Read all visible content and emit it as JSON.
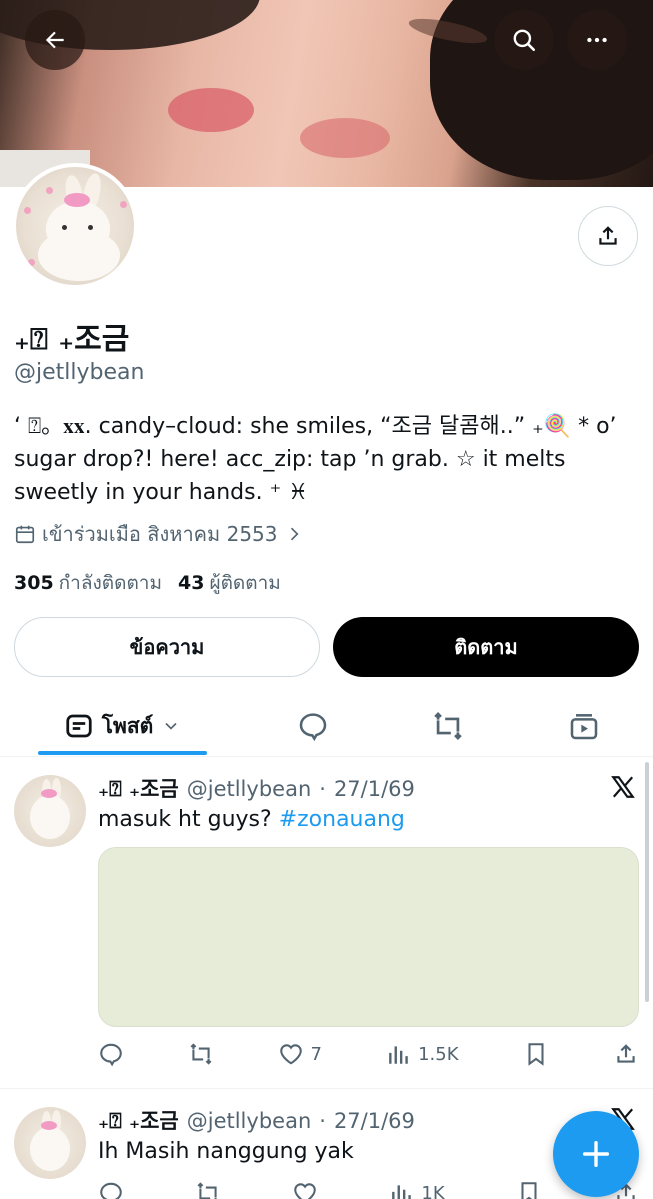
{
  "profile": {
    "display_name": "₊⍰ ₊조금",
    "handle": "@jetllybean",
    "bio": "‘ ⍰。𝐱𝐱. candy–cloud: she smiles, “조금 달콤해..” ₊🍭 * o’ sugar drop?! here! acc_zip: tap ’n grab. ☆ it melts sweetly in your hands. ⁺ ♓︎",
    "joined": "เข้าร่วมเมือ สิงหาคม 2553",
    "following_count": "305",
    "following_label": "กำลังติดตาม",
    "followers_count": "43",
    "followers_label": "ผู้ติดตาม"
  },
  "buttons": {
    "message": "ข้อความ",
    "follow": "ติดตาม"
  },
  "tabs": {
    "posts_label": "โพสต์"
  },
  "posts": [
    {
      "name": "₊⍰ ₊조금",
      "handle": "@jetllybean",
      "date": "27/1/69",
      "text": "masuk ht guys?",
      "hashtag": "#zonauang",
      "likes": "7",
      "views": "1.5K"
    },
    {
      "name": "₊⍰ ₊조금",
      "handle": "@jetllybean",
      "date": "27/1/69",
      "text": "Ih Masih nanggung yak",
      "views": "1K"
    }
  ],
  "colors": {
    "accent": "#1d9bf0",
    "text": "#0f1419",
    "muted": "#536471",
    "media_placeholder": "#e6ecd8"
  },
  "icons": [
    "back-arrow-icon",
    "search-icon",
    "more-icon",
    "share-icon",
    "calendar-icon",
    "chevron-right-icon",
    "post-tab-icon",
    "chevron-down-icon",
    "replies-tab-icon",
    "reposts-tab-icon",
    "media-tab-icon",
    "x-logo-icon",
    "reply-icon",
    "repost-icon",
    "like-icon",
    "views-icon",
    "bookmark-icon",
    "compose-icon"
  ]
}
